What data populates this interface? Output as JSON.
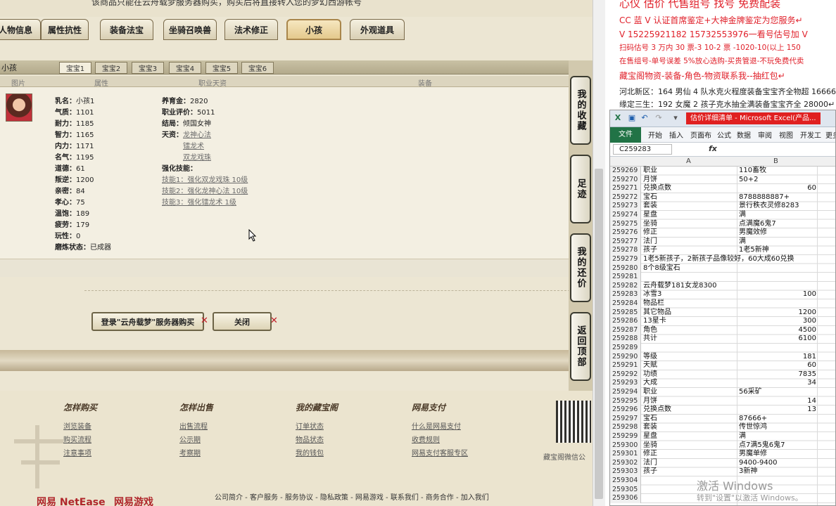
{
  "game": {
    "top_note": "该商品只能在云舟载梦服务器购买，购买后将直接转入您的梦幻西游帐号",
    "tabs": [
      "人物信息",
      "属性抗性",
      "装备法宝",
      "坐骑召唤兽",
      "法术修正",
      "小孩",
      "外观道具"
    ],
    "active_tab": "小孩",
    "panel_title": "小孩",
    "baby_tabs": [
      "宝宝1",
      "宝宝2",
      "宝宝3",
      "宝宝4",
      "宝宝5",
      "宝宝6"
    ],
    "columns": [
      "图片",
      "属性",
      "职业天资",
      "装备"
    ],
    "attributes": [
      {
        "k": "乳名：",
        "v": "小孩1"
      },
      {
        "k": "气质：",
        "v": "1101"
      },
      {
        "k": "耐力：",
        "v": "1185"
      },
      {
        "k": "智力：",
        "v": "1165"
      },
      {
        "k": "内力：",
        "v": "1171"
      },
      {
        "k": "名气：",
        "v": "1195"
      },
      {
        "k": "道德：",
        "v": "61"
      },
      {
        "k": "叛逆：",
        "v": "1200"
      },
      {
        "k": "亲密：",
        "v": "84"
      },
      {
        "k": "孝心：",
        "v": "75"
      },
      {
        "k": "温饱：",
        "v": "189"
      },
      {
        "k": "疲劳：",
        "v": "179"
      },
      {
        "k": "玩性：",
        "v": "0"
      },
      {
        "k": "磨炼状态：",
        "v": "已成器"
      }
    ],
    "career": {
      "raise_money_label": "养育金：",
      "raise_money": "2820",
      "rating_label": "职业评价：",
      "rating": "5011",
      "ending_label": "结局：",
      "ending": "倾国女神",
      "talent_label": "天资：",
      "talents": [
        "龙神心法",
        "镭龙术",
        "双龙戏珠"
      ],
      "skill_label": "强化技能：",
      "skills": [
        "技能1：强化双龙戏珠 10级",
        "技能2：强化龙神心法 10级",
        "技能3：强化镭龙术 1级"
      ]
    },
    "buttons": {
      "buy": "登录\"云舟载梦\"服务器购买",
      "close": "关闭"
    },
    "side_buttons": [
      "我的收藏",
      "足迹",
      "我的还价",
      "返回顶部"
    ],
    "footer": {
      "cols": [
        {
          "h": "怎样购买",
          "links": [
            "浏览装备",
            "购买流程",
            "注意事项"
          ]
        },
        {
          "h": "怎样出售",
          "links": [
            "出售流程",
            "公示期",
            "考察期"
          ]
        },
        {
          "h": "我的藏宝阁",
          "links": [
            "订单状态",
            "物品状态",
            "我的钱包"
          ]
        },
        {
          "h": "网易支付",
          "links": [
            "什么是网易支付",
            "收费规则",
            "网易支付客服专区"
          ]
        }
      ],
      "qr_caption": "藏宝阁微信公",
      "bottom_links": "公司简介 - 客户服务 - 服务协议 - 隐私政策 - 网易游戏 - 联系我们 - 商务合作 - 加入我们",
      "logo1": "网易 NetEase",
      "logo2": "网易游戏"
    }
  },
  "right_panel": {
    "heading": "心仪 估价 代售组号 找号 免费配装",
    "lines": [
      "CC 蓝 V 认证首席鉴定+大神金牌鉴定为您服务↵",
      "V 15225921182      15732553976一看号估号加 V",
      "扫码估号 3 万内 30 票-3 10-2 票 -1020-10(以上 150",
      "在售组号-单号误差 5%放心选购-买贵管退-不玩免费代卖",
      "藏宝阁物资-装备-角色-物资联系我--抽红包↵",
      "河北新区：164 男仙 4 队水克火程度装备宝宝齐全物超 16666",
      "缘定三生：192 女魔 2 孩子克水抽全满装备宝宝齐全 28000↵"
    ]
  },
  "excel": {
    "title": "估价详细清单 - Microsoft Excel(产品...",
    "ribbon": [
      "文件",
      "开始",
      "插入",
      "页面布",
      "公式",
      "数据",
      "审阅",
      "视图",
      "开发工",
      "更多"
    ],
    "name_box": "C259283",
    "fx": "fx",
    "col_a": "A",
    "col_b": "B",
    "rows": [
      {
        "n": "259269",
        "a": "职业",
        "b": "110畜牧",
        "num": false
      },
      {
        "n": "259270",
        "a": "月饼",
        "b": "50+2",
        "num": false
      },
      {
        "n": "259271",
        "a": "兑换点数",
        "b": "60",
        "num": true
      },
      {
        "n": "259272",
        "a": "宝石",
        "b": "8788888887+",
        "num": false
      },
      {
        "n": "259273",
        "a": "套装",
        "b": "景行秩衣灵修8283",
        "num": false
      },
      {
        "n": "259274",
        "a": "星盘",
        "b": "满",
        "num": false
      },
      {
        "n": "259275",
        "a": "坐骑",
        "b": "点满魔6鬼7",
        "num": false
      },
      {
        "n": "259276",
        "a": "修正",
        "b": "男魔效修",
        "num": false
      },
      {
        "n": "259277",
        "a": "法门",
        "b": "满",
        "num": false
      },
      {
        "n": "259278",
        "a": "孩子",
        "b": "1老5新神",
        "num": false
      },
      {
        "n": "259279",
        "a": "1老5新孩子，2新孩子品像较好，60大成60兑换",
        "b": "",
        "num": false
      },
      {
        "n": "259280",
        "a": "8个8级宝石",
        "b": "",
        "num": false
      },
      {
        "n": "259281",
        "a": "",
        "b": "",
        "num": false
      },
      {
        "n": "259282",
        "a": "云舟载梦181女龙8300",
        "b": "",
        "num": false
      },
      {
        "n": "259283",
        "a": "冰雪3",
        "b": "100",
        "num": true
      },
      {
        "n": "259284",
        "a": "物品栏",
        "b": "",
        "num": false
      },
      {
        "n": "259285",
        "a": "其它物品",
        "b": "1200",
        "num": true
      },
      {
        "n": "259286",
        "a": "13星卡",
        "b": "300",
        "num": true
      },
      {
        "n": "259287",
        "a": "角色",
        "b": "4500",
        "num": true
      },
      {
        "n": "259288",
        "a": "共计",
        "b": "6100",
        "num": true
      },
      {
        "n": "259289",
        "a": "",
        "b": "",
        "num": false
      },
      {
        "n": "259290",
        "a": "等级",
        "b": "181",
        "num": true
      },
      {
        "n": "259291",
        "a": "天赋",
        "b": "60",
        "num": true
      },
      {
        "n": "259292",
        "a": "功绩",
        "b": "7835",
        "num": true
      },
      {
        "n": "259293",
        "a": "大成",
        "b": "34",
        "num": true
      },
      {
        "n": "259294",
        "a": "职业",
        "b": "56采矿",
        "num": false
      },
      {
        "n": "259295",
        "a": "月饼",
        "b": "14",
        "num": true
      },
      {
        "n": "259296",
        "a": "兑换点数",
        "b": "13",
        "num": true
      },
      {
        "n": "259297",
        "a": "宝石",
        "b": "87666+",
        "num": false
      },
      {
        "n": "259298",
        "a": "套装",
        "b": "传世惊鸿",
        "num": false
      },
      {
        "n": "259299",
        "a": "星盘",
        "b": "满",
        "num": false
      },
      {
        "n": "259300",
        "a": "坐骑",
        "b": "点7满5鬼6鬼7",
        "num": false
      },
      {
        "n": "259301",
        "a": "修正",
        "b": "男魔单修",
        "num": false
      },
      {
        "n": "259302",
        "a": "法门",
        "b": "9400-9400",
        "num": false
      },
      {
        "n": "259303",
        "a": "孩子",
        "b": "3新神",
        "num": false
      },
      {
        "n": "259304",
        "a": "",
        "b": "",
        "num": false
      },
      {
        "n": "259305",
        "a": "",
        "b": "",
        "num": false
      },
      {
        "n": "259306",
        "a": "",
        "b": "",
        "num": false
      }
    ]
  },
  "watermark": {
    "line1": "激活 Windows",
    "line2": "转到\"设置\"以激活 Windows。"
  }
}
